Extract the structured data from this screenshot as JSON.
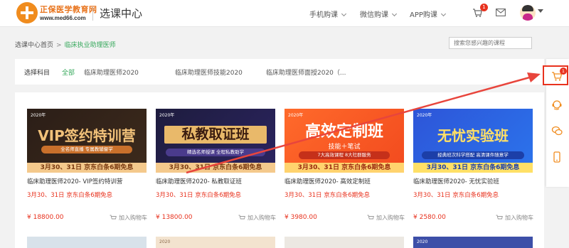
{
  "header": {
    "logo_name": "正保医学教育网",
    "logo_url": "www.med66.com",
    "page_title": "选课中心",
    "nav": [
      "手机购课",
      "微信购课",
      "APP购课"
    ],
    "cart_count": "1",
    "icons": [
      "cart-icon",
      "mail-icon",
      "avatar",
      "chevron-down-icon"
    ]
  },
  "breadcrumb": {
    "home": "选课中心首页",
    "separator": ">",
    "current": "临床执业助理医师"
  },
  "search": {
    "placeholder": "搜索您感兴趣的课程"
  },
  "filter": {
    "label": "选择科目",
    "items": [
      "全部",
      "临床助理医师2020",
      "临床助理医师技能2020",
      "临床助理医师面授2020（..."
    ]
  },
  "cards": [
    {
      "year": "2020年",
      "headline": "VIP签约特训营",
      "tagline": "全名师直播 专属教辅督学",
      "promo": "3月30、31日 京东白条6期免息",
      "title": "临床助理医师2020- VIP签约特训营",
      "subtitle": "3月30、31日 京东白条6期免息",
      "price": "¥ 18800.00",
      "cart_label": "加入购物车"
    },
    {
      "year": "2020年",
      "headline": "私教取证班",
      "tagline": "精选名师授课 全程私教助学",
      "promo": "3月30、31日 京东白条6期免息",
      "title": "临床助理医师2020- 私教取证班",
      "subtitle": "3月30、31日 京东白条6期免息",
      "price": "¥ 13800.00",
      "cart_label": "加入购物车"
    },
    {
      "year": "2020年",
      "headline": "高效定制班",
      "tagline": "技能＋笔试",
      "tagline2": "7大高效课程 8大社群服务",
      "promo": "3月30、31日 京东白条6期免息",
      "title": "临床助理医师2020- 高效定制班",
      "subtitle": "3月30、31日 京东白条6期免息",
      "price": "¥ 3980.00",
      "cart_label": "加入购物车"
    },
    {
      "year": "2020年",
      "headline": "无忧实验班",
      "tagline": "经典班次科学搭配 高清课件随意学",
      "promo": "3月30、31日 京东白条6期免息",
      "title": "临床助理医师2020- 无忧实验班",
      "subtitle": "3月30、31日 京东白条6期免息",
      "price": "¥ 2580.00",
      "cart_label": "加入购物车"
    }
  ],
  "second_row_years": [
    "",
    "2020",
    "",
    "2020"
  ],
  "sidebar": {
    "cart_count": "1",
    "icons": [
      "cart-icon",
      "headset-icon",
      "chat-icon",
      "phone-icon"
    ]
  },
  "colors": {
    "brand_orange": "#f08c1e",
    "accent_green": "#35a85b",
    "price_red": "#e8321e"
  }
}
